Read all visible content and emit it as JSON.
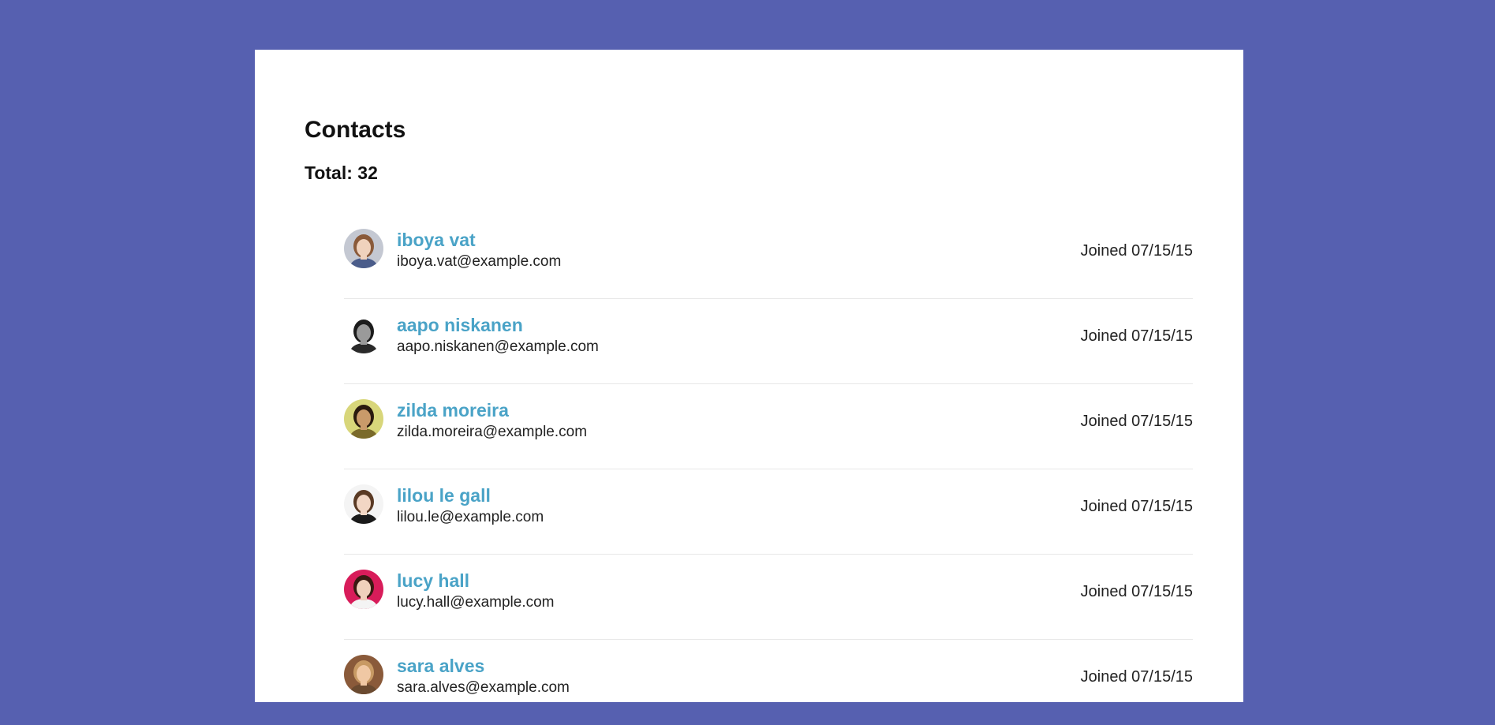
{
  "header": {
    "title": "Contacts",
    "total_label": "Total: 32"
  },
  "contacts": [
    {
      "name": "iboya vat",
      "email": "iboya.vat@example.com",
      "joined": "Joined 07/15/15",
      "avatar": {
        "bg": "#c4c8d2",
        "hair": "#8a5a3a",
        "skin": "#f0d2bd",
        "shirt": "#4a5c8a"
      }
    },
    {
      "name": "aapo niskanen",
      "email": "aapo.niskanen@example.com",
      "joined": "Joined 07/15/15",
      "avatar": {
        "bg": "#ffffff",
        "hair": "#1c1c1c",
        "skin": "#9a9a9a",
        "shirt": "#2a2a2a"
      }
    },
    {
      "name": "zilda moreira",
      "email": "zilda.moreira@example.com",
      "joined": "Joined 07/15/15",
      "avatar": {
        "bg": "#d8d67a",
        "hair": "#2a1a0e",
        "skin": "#c99a6a",
        "shirt": "#7a6a2a"
      }
    },
    {
      "name": "lilou le gall",
      "email": "lilou.le@example.com",
      "joined": "Joined 07/15/15",
      "avatar": {
        "bg": "#f4f4f4",
        "hair": "#5a3a24",
        "skin": "#f2d6c4",
        "shirt": "#1a1a1a"
      }
    },
    {
      "name": "lucy hall",
      "email": "lucy.hall@example.com",
      "joined": "Joined 07/15/15",
      "avatar": {
        "bg": "#d81c5a",
        "hair": "#3a1a12",
        "skin": "#f0d0bc",
        "shirt": "#f4f4f4"
      }
    },
    {
      "name": "sara alves",
      "email": "sara.alves@example.com",
      "joined": "Joined 07/15/15",
      "avatar": {
        "bg": "#8a5a3a",
        "hair": "#c89a64",
        "skin": "#f0c8a4",
        "shirt": "#6a4a30"
      }
    }
  ]
}
